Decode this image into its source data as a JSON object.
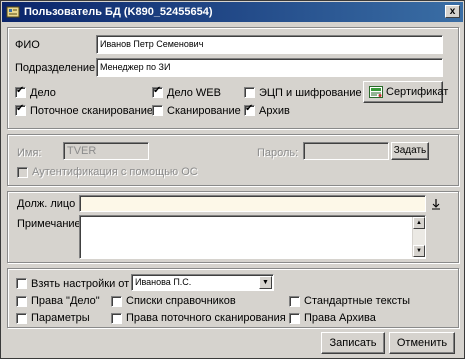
{
  "window": {
    "title": "Пользователь БД   (K890_52455654)",
    "close_glyph": "x"
  },
  "profile": {
    "fio_label": "ФИО",
    "fio_value": "Иванов Петр Семенович",
    "department_label": "Подразделение",
    "department_value": "Менеджер по ЗИ"
  },
  "rights": {
    "delo": {
      "label": "Дело",
      "checked": true
    },
    "delo_web": {
      "label": "Дело WEB",
      "checked": true
    },
    "ecp": {
      "label": "ЭЦП и шифрование",
      "checked": false
    },
    "stream_scan": {
      "label": "Поточное сканирование",
      "checked": true
    },
    "scan": {
      "label": "Сканирование",
      "checked": false
    },
    "archive": {
      "label": "Архив",
      "checked": true
    },
    "certificate_button": "Сертификат"
  },
  "login": {
    "name_label": "Имя:",
    "name_value": "TVER",
    "password_label": "Пароль:",
    "password_value": "",
    "set_button": "Задать",
    "os_auth_label": "Аутентификация с помощью ОС"
  },
  "details": {
    "position_label": "Долж. лицо",
    "position_value": "",
    "note_label": "Примечание",
    "note_value": ""
  },
  "settings": {
    "take_settings_label": "Взять настройки от",
    "take_settings_value": "Иванова П.С.",
    "rights_delo": "Права \"Дело\"",
    "ref_lists": "Списки справочников",
    "std_texts": "Стандартные тексты",
    "params": "Параметры",
    "stream_scan_rights": "Права поточного сканирования",
    "archive_rights": "Права Архива"
  },
  "footer": {
    "save_button": "Записать",
    "cancel_button": "Отменить"
  }
}
